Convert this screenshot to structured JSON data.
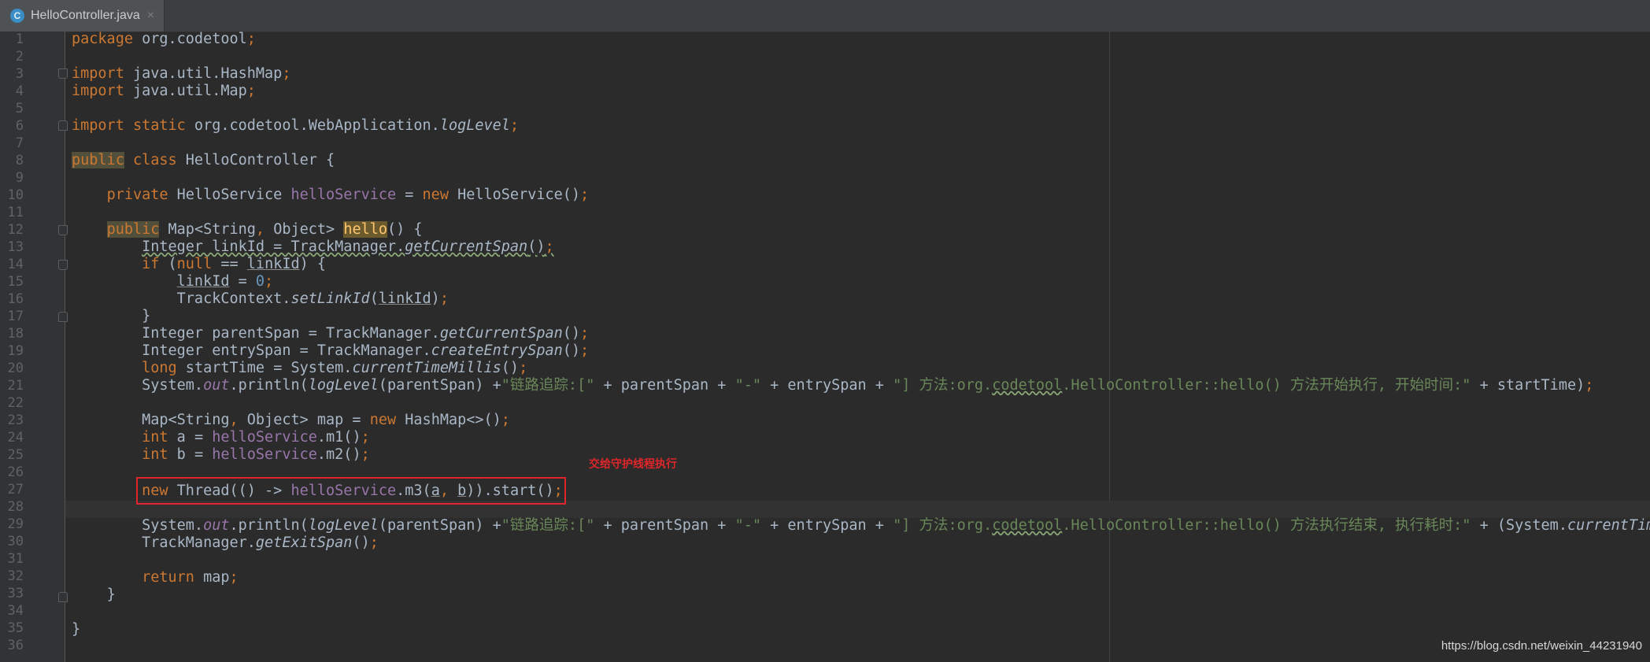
{
  "tab": {
    "file_name": "HelloController.java",
    "icon_letter": "C",
    "close_glyph": "×"
  },
  "annotation": "交给守护线程执行",
  "watermark": "https://blog.csdn.net/weixin_44231940",
  "line_numbers": [
    "1",
    "2",
    "3",
    "4",
    "5",
    "6",
    "7",
    "8",
    "9",
    "10",
    "11",
    "12",
    "13",
    "14",
    "15",
    "16",
    "17",
    "18",
    "19",
    "20",
    "21",
    "22",
    "23",
    "24",
    "25",
    "26",
    "27",
    "28",
    "29",
    "30",
    "31",
    "32",
    "33",
    "34",
    "35",
    "36"
  ],
  "tokens": {
    "l1_kw": "package",
    "l1_rest": " org.codetool",
    "l1_semi": ";",
    "l3_kw": "import",
    "l3_rest": " java.util.HashMap",
    "l3_semi": ";",
    "l4_kw": "import",
    "l4_rest": " java.util.Map",
    "l4_semi": ";",
    "l6_kw": "import static",
    "l6_rest": " org.codetool.WebApplication.",
    "l6_it": "logLevel",
    "l6_semi": ";",
    "l8_kw1": "public",
    "l8_kw2": " class",
    "l8_rest": " HelloController {",
    "l10_kw": "private",
    "l10_a": " HelloService ",
    "l10_fld": "helloService",
    "l10_b": " = ",
    "l10_new": "new",
    "l10_c": " HelloService()",
    "l10_semi": ";",
    "l12_kw": "public",
    "l12_a": " Map<String",
    "l12_comma": ",",
    "l12_b": " Object> ",
    "l12_name": "hello",
    "l12_c": "() {",
    "l13_a": "Integer linkId = TrackManager.",
    "l13_it": "getCurrentSpan",
    "l13_b": "()",
    "l13_semi": ";",
    "l14_kw": "if",
    "l14_a": " (",
    "l14_null": "null",
    "l14_b": " == ",
    "l14_u": "linkId",
    "l14_c": ") {",
    "l15_u": "linkId",
    "l15_a": " = ",
    "l15_num": "0",
    "l15_semi": ";",
    "l16_a": "TrackContext.",
    "l16_it": "setLinkId",
    "l16_b": "(",
    "l16_u": "linkId",
    "l16_c": ")",
    "l16_semi": ";",
    "l17": "}",
    "l18_a": "Integer parentSpan = TrackManager.",
    "l18_it": "getCurrentSpan",
    "l18_b": "()",
    "l18_semi": ";",
    "l19_a": "Integer entrySpan = TrackManager.",
    "l19_it": "createEntrySpan",
    "l19_b": "()",
    "l19_semi": ";",
    "l20_kw": "long",
    "l20_a": " startTime = System.",
    "l20_it": "currentTimeMillis",
    "l20_b": "()",
    "l20_semi": ";",
    "l21_a": "System.",
    "l21_out": "out",
    "l21_b": ".println(",
    "l21_ll": "logLevel",
    "l21_c": "(parentSpan) +",
    "l21_s1": "\"链路追踪:[\"",
    "l21_d": " + parentSpan + ",
    "l21_s2": "\"-\"",
    "l21_e": " + entrySpan + ",
    "l21_s3a": "\"] 方法:org.",
    "l21_s3w": "codetool",
    "l21_s3b": ".HelloController::hello() 方法开始执行, 开始时间:\"",
    "l21_f": " + startTime)",
    "l21_semi": ";",
    "l23_a": "Map<String",
    "l23_comma": ",",
    "l23_b": " Object> map = ",
    "l23_new": "new",
    "l23_c": " HashMap<>()",
    "l23_semi": ";",
    "l24_kw": "int",
    "l24_a": " a = ",
    "l24_fld": "helloService",
    "l24_b": ".m1()",
    "l24_semi": ";",
    "l25_kw": "int",
    "l25_a": " b = ",
    "l25_fld": "helloService",
    "l25_b": ".m2()",
    "l25_semi": ";",
    "l27_new": "new",
    "l27_a": " Thread(() -> ",
    "l27_fld": "helloService",
    "l27_b": ".m3(",
    "l27_ua": "a",
    "l27_comma": ",",
    "l27_ub": "b",
    "l27_c": ")).start()",
    "l27_semi": ";",
    "l29_a": "System.",
    "l29_out": "out",
    "l29_b": ".println(",
    "l29_ll": "logLevel",
    "l29_c": "(parentSpan) +",
    "l29_s1": "\"链路追踪:[\"",
    "l29_d": " + parentSpan + ",
    "l29_s2": "\"-\"",
    "l29_e": " + entrySpan + ",
    "l29_s3a": "\"] 方法:org.",
    "l29_s3w": "codetool",
    "l29_s3b": ".HelloController::hello() 方法执行结束, 执行耗时:\"",
    "l29_f": " + (System.",
    "l29_it": "currentTime",
    "l30_a": "TrackManager.",
    "l30_it": "getExitSpan",
    "l30_b": "()",
    "l30_semi": ";",
    "l32_kw": "return",
    "l32_a": " map",
    "l32_semi": ";",
    "l33": "}",
    "l35": "}"
  }
}
